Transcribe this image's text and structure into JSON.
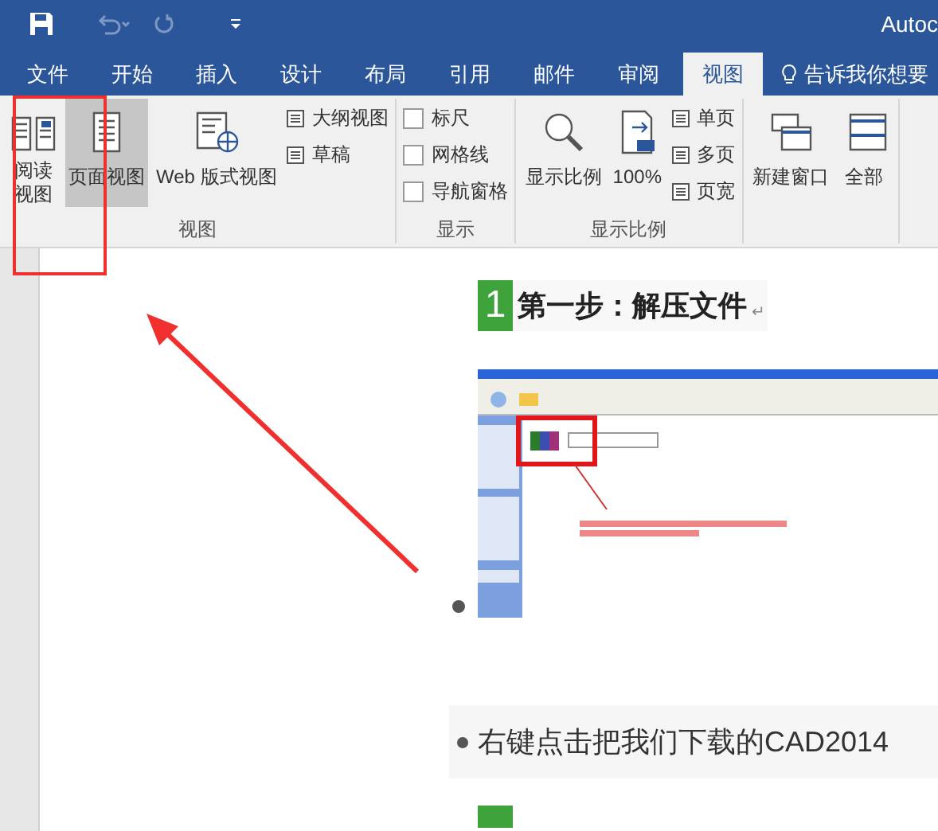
{
  "window": {
    "title": "Autoc"
  },
  "tabs": [
    {
      "label": "文件",
      "selected": false
    },
    {
      "label": "开始",
      "selected": false
    },
    {
      "label": "插入",
      "selected": false
    },
    {
      "label": "设计",
      "selected": false
    },
    {
      "label": "布局",
      "selected": false
    },
    {
      "label": "引用",
      "selected": false
    },
    {
      "label": "邮件",
      "selected": false
    },
    {
      "label": "审阅",
      "selected": false
    },
    {
      "label": "视图",
      "selected": true
    }
  ],
  "tell_me": "告诉我你想要",
  "ribbon": {
    "groups": [
      {
        "label": "视图",
        "items": [
          {
            "kind": "large",
            "label": "阅读视图",
            "selected": false
          },
          {
            "kind": "large",
            "label": "页面视图",
            "selected": true
          },
          {
            "kind": "large",
            "label": "Web 版式视图",
            "selected": false
          },
          {
            "kind": "small",
            "label": "大纲视图"
          },
          {
            "kind": "small",
            "label": "草稿"
          }
        ]
      },
      {
        "label": "显示",
        "items": [
          {
            "kind": "check",
            "label": "标尺",
            "checked": false
          },
          {
            "kind": "check",
            "label": "网格线",
            "checked": false
          },
          {
            "kind": "check",
            "label": "导航窗格",
            "checked": false
          }
        ]
      },
      {
        "label": "显示比例",
        "items": [
          {
            "kind": "large",
            "label": "显示比例",
            "selected": false
          },
          {
            "kind": "large",
            "label": "100%",
            "selected": false
          },
          {
            "kind": "small",
            "label": "单页"
          },
          {
            "kind": "small",
            "label": "多页"
          },
          {
            "kind": "small",
            "label": "页宽"
          }
        ]
      },
      {
        "items": [
          {
            "kind": "large",
            "label": "新建窗口",
            "selected": false
          },
          {
            "kind": "large",
            "label": "全部",
            "selected": false
          }
        ]
      }
    ]
  },
  "document": {
    "blocks": [
      {
        "kind": "heading",
        "number": "1",
        "text": "第一步：解压文件",
        "mark": "↵"
      },
      {
        "kind": "picture"
      },
      {
        "kind": "bullet",
        "text": "右键点击把我们下载的CAD2014"
      },
      {
        "kind": "cut_heading"
      }
    ]
  }
}
